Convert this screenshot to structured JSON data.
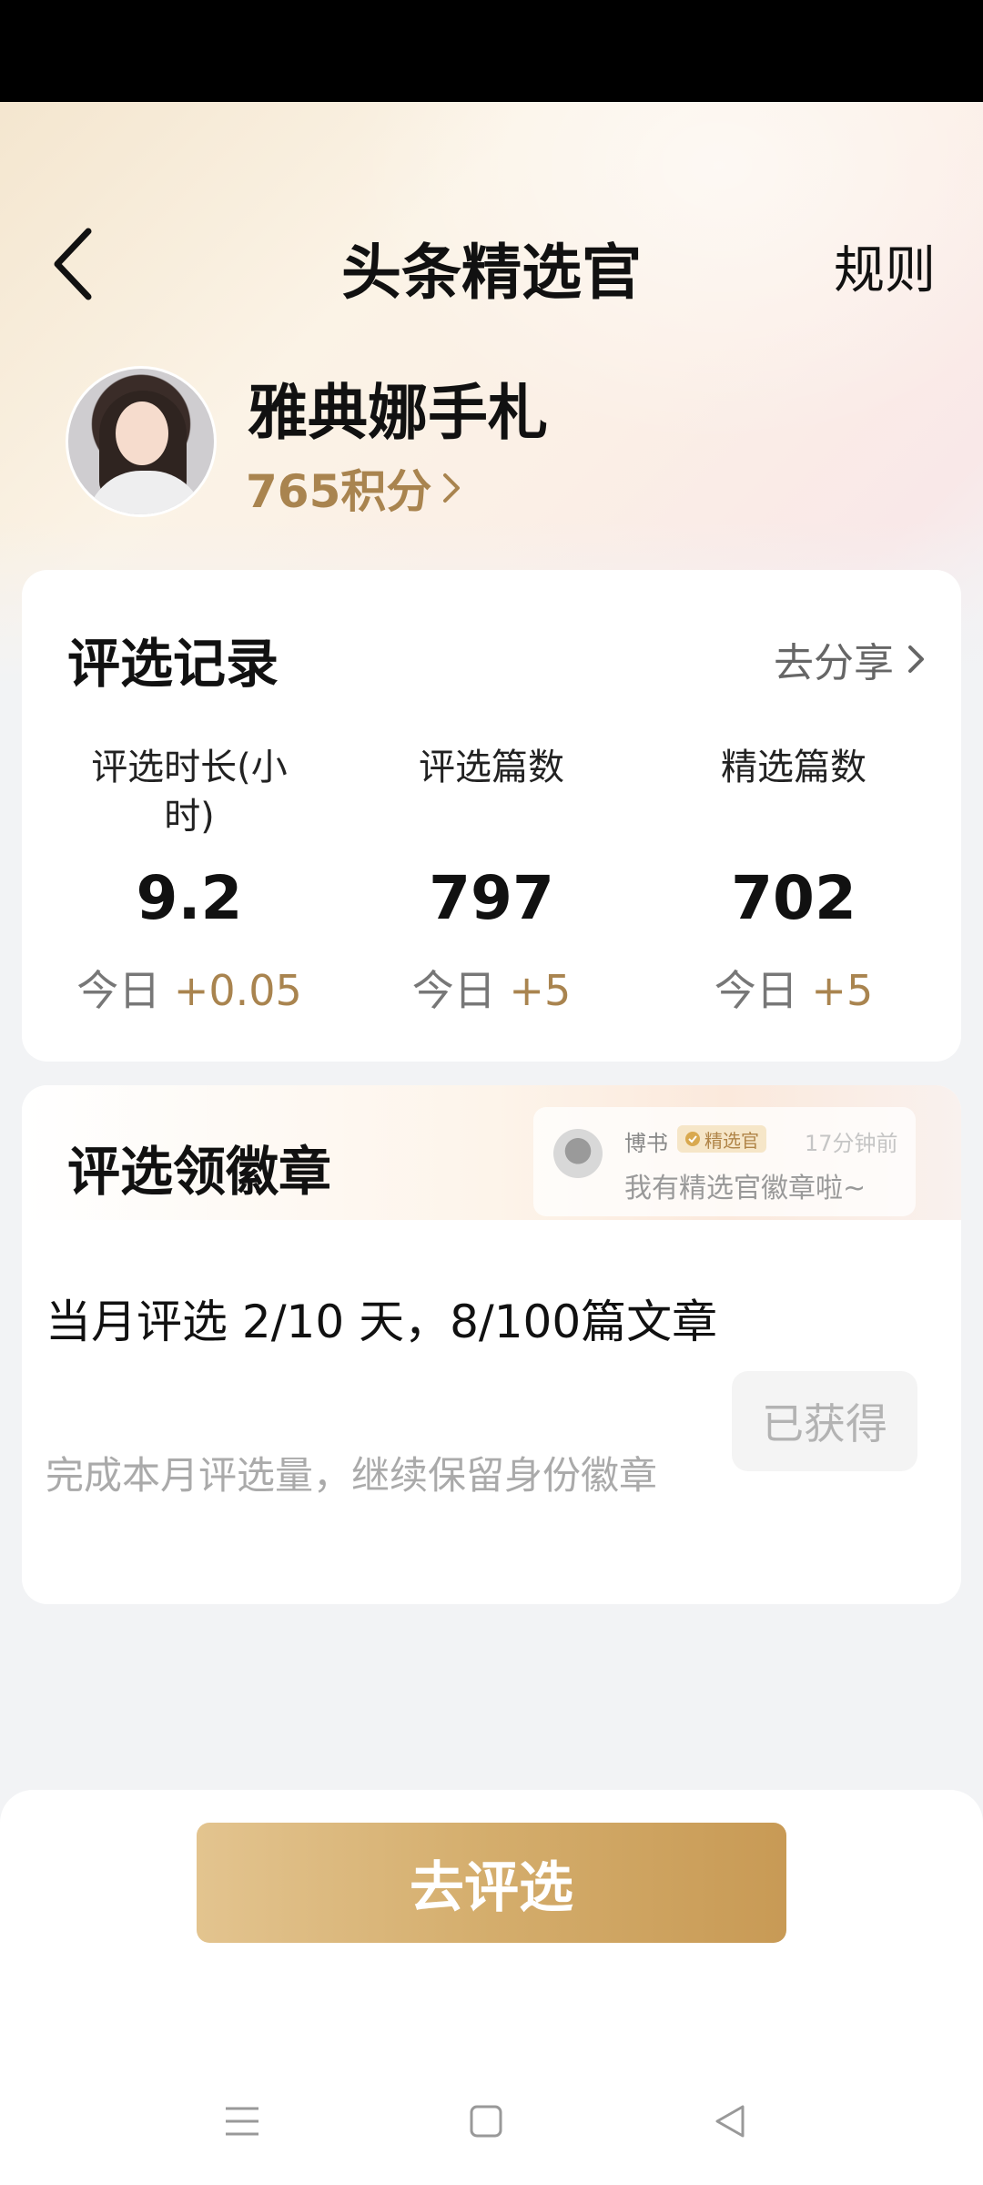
{
  "header": {
    "title": "头条精选官",
    "rules_label": "规则"
  },
  "profile": {
    "name": "雅典娜手札",
    "points_text": "765积分"
  },
  "record_card": {
    "title": "评选记录",
    "share_label": "去分享",
    "stats": [
      {
        "label": "评选时长(小时)",
        "value": "9.2",
        "today_prefix": "今日",
        "today_delta": "+0.05"
      },
      {
        "label": "评选篇数",
        "value": "797",
        "today_prefix": "今日",
        "today_delta": "+5"
      },
      {
        "label": "精选篇数",
        "value": "702",
        "today_prefix": "今日",
        "today_delta": "+5"
      }
    ]
  },
  "badge_card": {
    "title": "评选领徽章",
    "toast": {
      "user": "博书",
      "badge": "精选官",
      "time": "17分钟前",
      "message": "我有精选官徽章啦~"
    },
    "progress_text": "当月评选 2/10 天，8/100篇文章",
    "hint_text": "完成本月评选量，继续保留身份徽章",
    "status_button": "已获得"
  },
  "footer": {
    "primary_button": "去评选"
  },
  "icons": {
    "back": "back-arrow-icon",
    "chevron": "chevron-right-icon",
    "verified": "check-circle-icon",
    "nav_menu": "menu-icon",
    "nav_home": "home-square-icon",
    "nav_back": "back-triangle-icon"
  },
  "colors": {
    "accent_gold": "#a9844f",
    "button_gold_start": "#e3c48f",
    "button_gold_end": "#c89a55"
  }
}
